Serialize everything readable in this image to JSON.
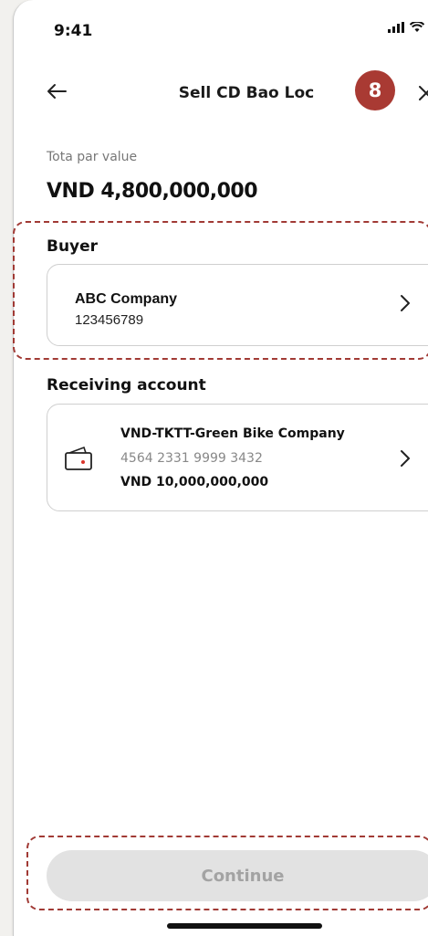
{
  "status_bar": {
    "time": "9:41"
  },
  "header": {
    "title": "Sell CD Bao Loc",
    "step_badge": "8"
  },
  "total": {
    "label": "Tota par value",
    "value": "VND 4,800,000,000"
  },
  "buyer": {
    "section_title": "Buyer",
    "name": "ABC Company",
    "id": "123456789"
  },
  "receiving": {
    "section_title": "Receiving account",
    "account_name": "VND-TKTT-Green Bike Company",
    "account_number": "4564 2331 9999 3432",
    "balance": "VND 10,000,000,000"
  },
  "footer": {
    "continue_label": "Continue"
  },
  "colors": {
    "accent": "#a93a33",
    "disabled_bg": "#e2e2e2",
    "disabled_text": "#a3a3a3"
  }
}
